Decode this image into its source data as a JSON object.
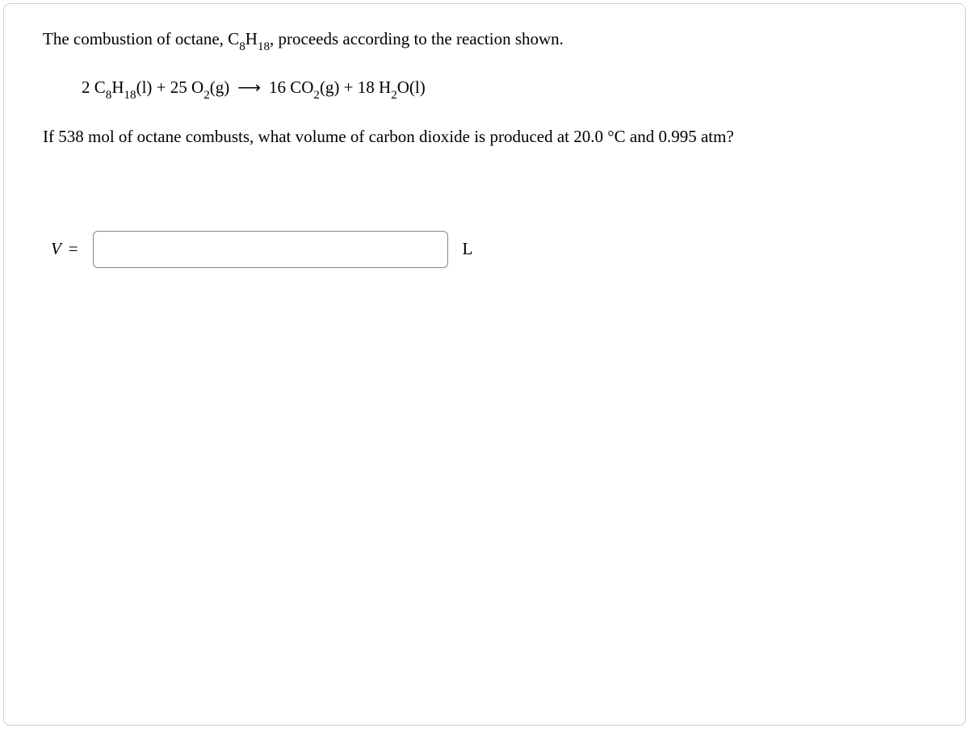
{
  "intro": {
    "prefix": "The combustion of octane, C",
    "sub1": "8",
    "mid1": "H",
    "sub2": "18",
    "suffix": ", proceeds according to the reaction shown."
  },
  "equation": {
    "c1": "2 C",
    "s1": "8",
    "c2": "H",
    "s2": "18",
    "c3": "(l) + 25 O",
    "s3": "2",
    "c4": "(g)",
    "arrow": "⟶",
    "c5": "16 CO",
    "s5": "2",
    "c6": "(g) + 18 H",
    "s6": "2",
    "c7": "O(l)"
  },
  "question": "If 538 mol of octane combusts, what volume of carbon dioxide is produced at 20.0 °C and 0.995 atm?",
  "answer": {
    "variable": "V",
    "equals": "=",
    "value": "",
    "unit": "L"
  }
}
